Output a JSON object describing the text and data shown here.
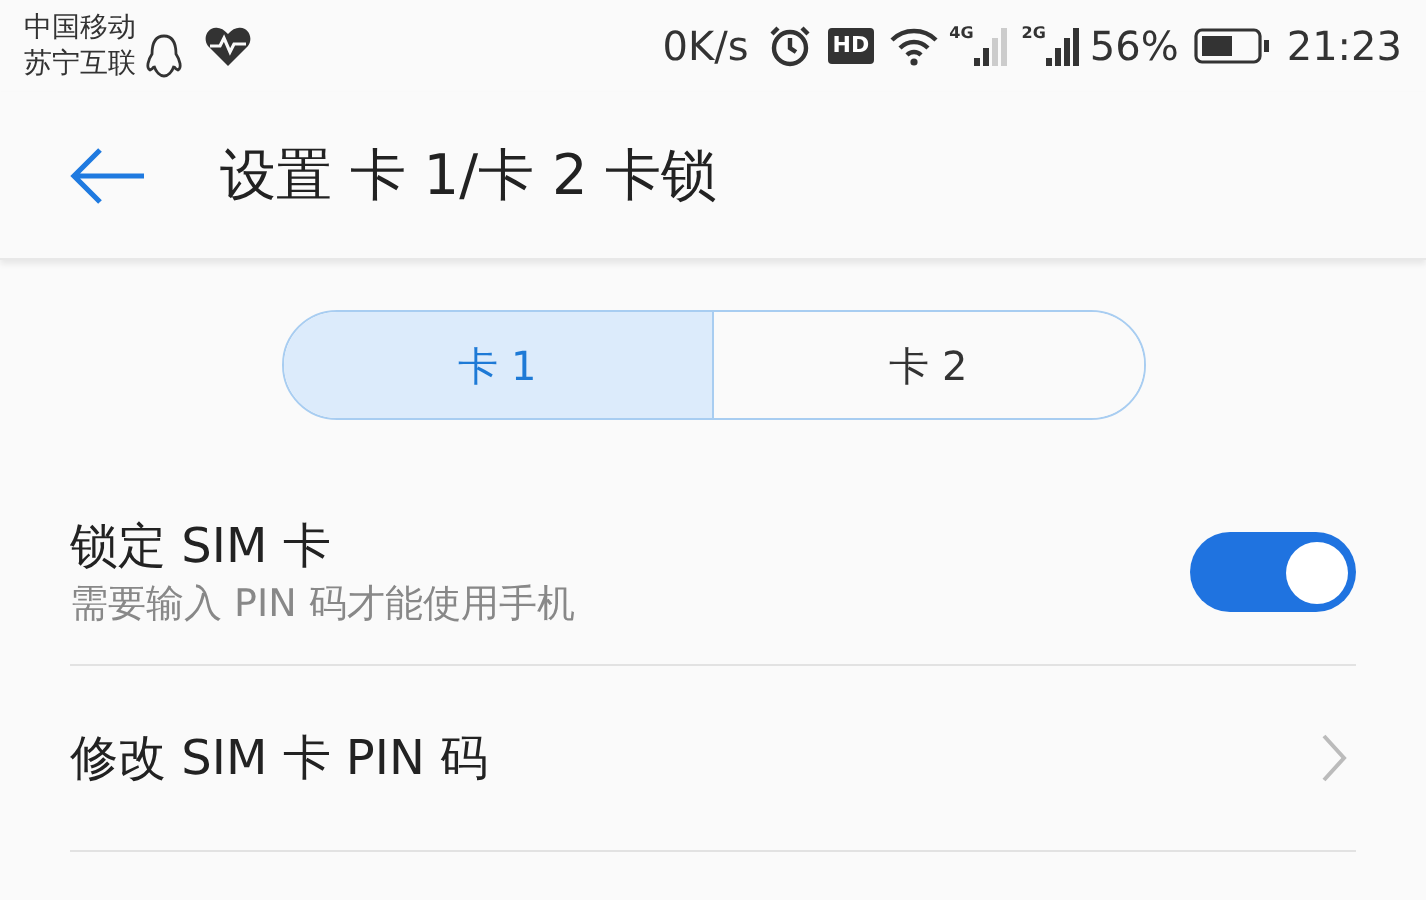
{
  "status_bar": {
    "carriers": [
      "中国移动",
      "苏宁互联"
    ],
    "speed": "0K/s",
    "hd": "HD",
    "sim1_network": "4G",
    "sim2_network": "2G",
    "battery": "56%",
    "time": "21:23"
  },
  "toolbar": {
    "title": "设置 卡 1/卡 2 卡锁"
  },
  "tabs": [
    {
      "label": "卡 1",
      "selected": true
    },
    {
      "label": "卡 2",
      "selected": false
    }
  ],
  "settings": [
    {
      "kind": "switch",
      "title": "锁定 SIM 卡",
      "subtitle": "需要输入 PIN 码才能使用手机",
      "on": true
    },
    {
      "kind": "link",
      "title": "修改 SIM 卡 PIN 码"
    }
  ]
}
